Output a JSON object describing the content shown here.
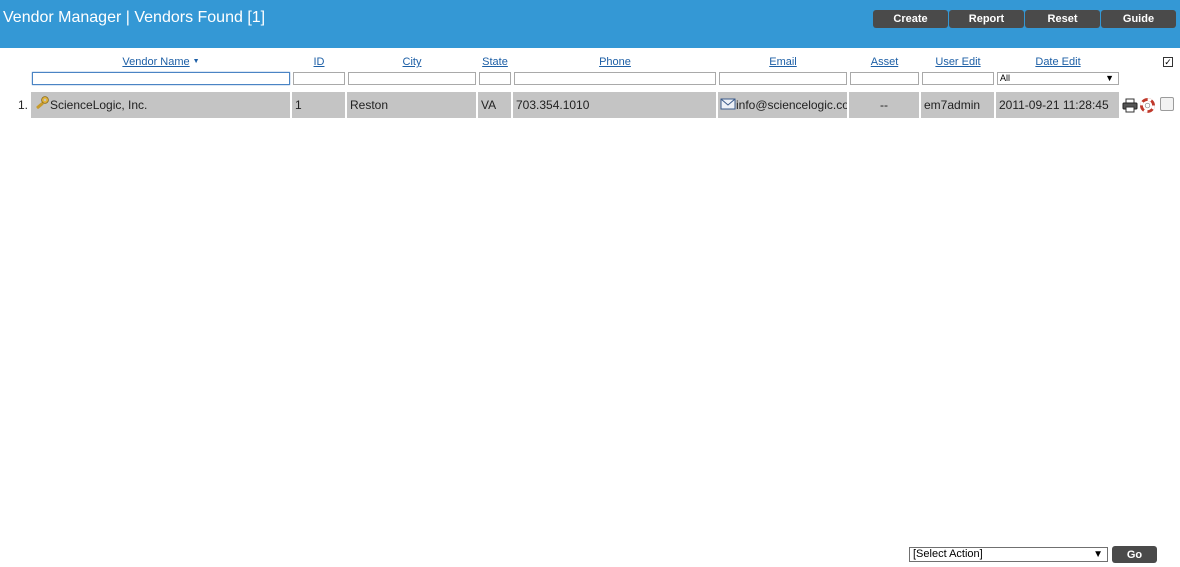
{
  "header": {
    "title": "Vendor Manager | Vendors Found [1]",
    "buttons": {
      "create": "Create",
      "report": "Report",
      "reset": "Reset",
      "guide": "Guide"
    }
  },
  "columns": {
    "vendor_name": "Vendor Name",
    "id": "ID",
    "city": "City",
    "state": "State",
    "phone": "Phone",
    "email": "Email",
    "asset": "Asset",
    "user_edit": "User Edit",
    "date_edit": "Date Edit"
  },
  "filters": {
    "vendor_name": "",
    "id": "",
    "city": "",
    "state": "",
    "phone": "",
    "email": "",
    "asset": "",
    "user_edit": "",
    "date_edit_selected": "All"
  },
  "rows": [
    {
      "num": "1.",
      "vendor_name": "ScienceLogic, Inc.",
      "id": "1",
      "city": "Reston",
      "state": "VA",
      "phone": "703.354.1010",
      "email": "info@sciencelogic.com",
      "asset": "--",
      "user_edit": "em7admin",
      "date_edit": "2011-09-21 11:28:45"
    }
  ],
  "footer": {
    "action_select": "[Select Action]",
    "go": "Go"
  },
  "colors": {
    "header_bg": "#3498d5",
    "button_bg": "#4a4a4a",
    "row_bg": "#c4c4c4",
    "link": "#1d5fa6"
  },
  "icons": {
    "vendor": "wrench-icon",
    "email": "envelope-icon",
    "print": "printer-icon",
    "support": "lifebuoy-icon"
  }
}
